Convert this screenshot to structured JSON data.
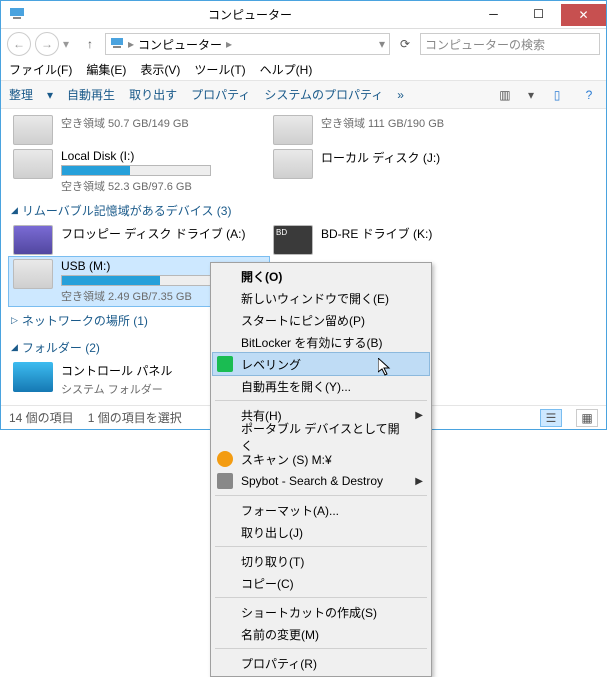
{
  "title": "コンピューター",
  "address": {
    "crumb": "コンピューター"
  },
  "search": {
    "placeholder": "コンピューターの検索"
  },
  "menubar": {
    "file": "ファイル(F)",
    "edit": "編集(E)",
    "view": "表示(V)",
    "tools": "ツール(T)",
    "help": "ヘルプ(H)"
  },
  "toolbar": {
    "organize": "整理",
    "autoplay": "自動再生",
    "eject": "取り出す",
    "properties": "プロパティ",
    "sysproperties": "システムのプロパティ",
    "overflow": "»"
  },
  "drives": {
    "top_sub_left": "空き領域 50.7 GB/149 GB",
    "top_sub_right": "空き領域 111 GB/190 GB",
    "local_i": {
      "name": "Local Disk (I:)",
      "sub": "空き領域 52.3 GB/97.6 GB",
      "fill_pct": 46
    },
    "local_j": {
      "name": "ローカル ディスク (J:)"
    },
    "group_removable": "リムーバブル記憶域があるデバイス (3)",
    "floppy": {
      "name": "フロッピー ディスク ドライブ (A:)"
    },
    "bdre": {
      "name": "BD-RE ドライブ (K:)"
    },
    "usb": {
      "name": "USB (M:)",
      "sub": "空き領域 2.49 GB/7.35 GB",
      "fill_pct": 66
    },
    "group_network": "ネットワークの場所 (1)",
    "group_folders": "フォルダー (2)",
    "control_panel": {
      "name": "コントロール パネル",
      "sub": "システム フォルダー"
    }
  },
  "status": {
    "items": "14 個の項目",
    "sel": "1 個の項目を選択"
  },
  "ctx": {
    "open": "開く(O)",
    "open_new": "新しいウィンドウで開く(E)",
    "pin": "スタートにピン留め(P)",
    "bitlocker": "BitLocker を有効にする(B)",
    "leveling": "レベリング",
    "autoplay_open": "自動再生を開く(Y)...",
    "share": "共有(H)",
    "portable": "ポータブル デバイスとして開く",
    "scan": "スキャン (S) M:¥",
    "spybot": "Spybot - Search & Destroy",
    "format": "フォーマット(A)...",
    "eject": "取り出し(J)",
    "cut": "切り取り(T)",
    "copy": "コピー(C)",
    "shortcut": "ショートカットの作成(S)",
    "rename": "名前の変更(M)",
    "properties": "プロパティ(R)"
  }
}
